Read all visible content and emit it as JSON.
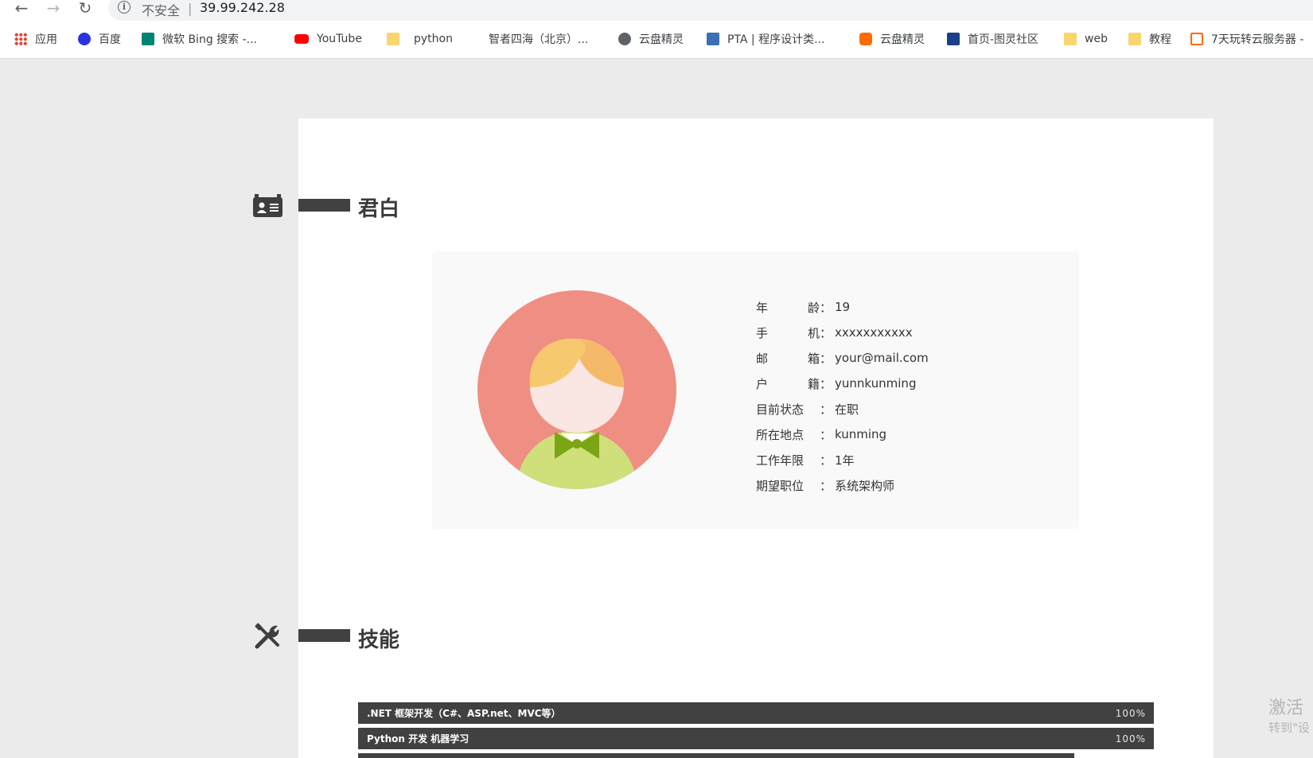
{
  "browser": {
    "insecure_label": "不安全",
    "separator": "|",
    "url": "39.99.242.28",
    "bookmarks": [
      {
        "label": "应用",
        "icon": "apps-icon"
      },
      {
        "label": "百度",
        "icon": "baidu-icon"
      },
      {
        "label": "微软 Bing 搜索 -...",
        "icon": "bing-icon"
      },
      {
        "label": "YouTube",
        "icon": "youtube-icon"
      },
      {
        "label": "python",
        "icon": "folder-icon"
      },
      {
        "label": "智者四海（北京）...",
        "icon": ""
      },
      {
        "label": "云盘精灵",
        "icon": "globe-icon"
      },
      {
        "label": "PTA | 程序设计类...",
        "icon": "pta-icon"
      },
      {
        "label": "云盘精灵",
        "icon": "yunpan-icon"
      },
      {
        "label": "首页-图灵社区",
        "icon": "turing-icon"
      },
      {
        "label": "web",
        "icon": "folder-icon"
      },
      {
        "label": "教程",
        "icon": "folder-icon"
      },
      {
        "label": "7天玩转云服务器 -",
        "icon": "aliyun-icon"
      }
    ]
  },
  "sections": {
    "about": {
      "title": "君白",
      "icon": "id-card-icon"
    },
    "skills": {
      "title": "技能",
      "icon": "tools-icon"
    }
  },
  "profile": {
    "rows": [
      {
        "key": [
          "年",
          "龄"
        ],
        "value": "19"
      },
      {
        "key": [
          "手",
          "机"
        ],
        "value": "xxxxxxxxxxx"
      },
      {
        "key": [
          "邮",
          "箱"
        ],
        "value": "your@mail.com"
      },
      {
        "key": [
          "户",
          "籍"
        ],
        "value": "yunnkunming"
      },
      {
        "key": [
          "目前状态"
        ],
        "value": "在职"
      },
      {
        "key": [
          "所在地点"
        ],
        "value": "kunming"
      },
      {
        "key": [
          "工作年限"
        ],
        "value": "1年"
      },
      {
        "key": [
          "期望职位"
        ],
        "value": "系统架构师"
      }
    ],
    "colon": "："
  },
  "skills": [
    {
      "label": ".NET 框架开发（C#、ASP.net、MVC等）",
      "percent": "100%"
    },
    {
      "label": "Python 开发 机器学习",
      "percent": "100%"
    }
  ],
  "watermark": {
    "line1": "激活",
    "line2": "转到\"设"
  },
  "colors": {
    "page_bg": "#ebebeb",
    "bar": "#414141",
    "avatar_bg": "#ef8f84",
    "shirt": "#cfe07a",
    "bowtie": "#7aa514",
    "hair": "#f7c96e"
  }
}
